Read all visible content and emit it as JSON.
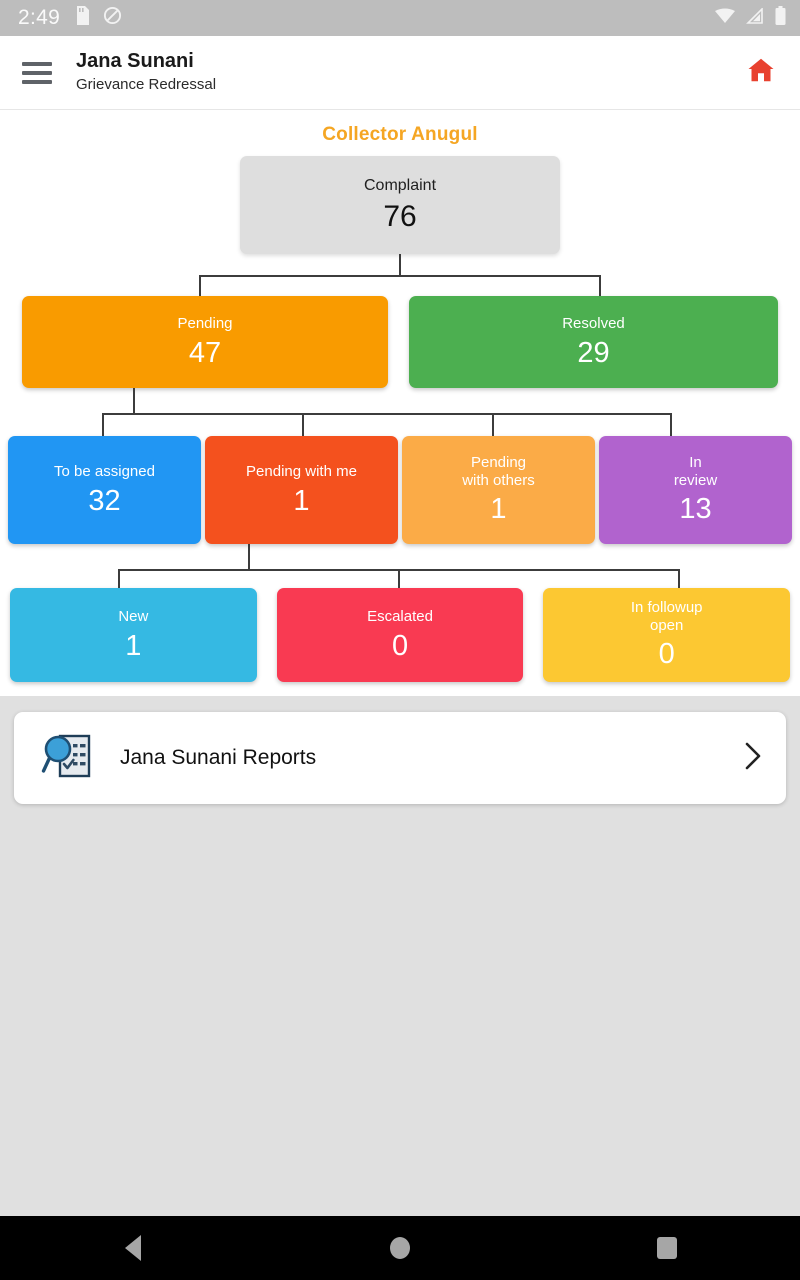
{
  "statusbar": {
    "time": "2:49",
    "icons_left": [
      "sd-card-icon",
      "do-not-disturb-icon"
    ],
    "icons_right": [
      "wifi-icon",
      "cellular-signal-icon",
      "battery-icon"
    ]
  },
  "appbar": {
    "menu_icon": "hamburger-menu-icon",
    "title": "Jana Sunani",
    "subtitle": "Grievance Redressal",
    "home_icon": "home-icon",
    "home_color": "#e8412f"
  },
  "dashboard": {
    "section_title": "Collector Anugul",
    "section_title_color": "#f5a623",
    "root": {
      "label": "Complaint",
      "value": "76",
      "color": "#dedede"
    },
    "level2": [
      {
        "label": "Pending",
        "value": "47",
        "color": "#f99b00"
      },
      {
        "label": "Resolved",
        "value": "29",
        "color": "#4caf50"
      }
    ],
    "level3": [
      {
        "label": "To be assigned",
        "value": "32",
        "color": "#2196f3"
      },
      {
        "label": "Pending with me",
        "value": "1",
        "color": "#f4511e"
      },
      {
        "label_line1": "Pending",
        "label_line2": "with others",
        "value": "1",
        "color": "#fbab47"
      },
      {
        "label_line1": "In",
        "label_line2": "review",
        "value": "13",
        "color": "#b163ce"
      }
    ],
    "level4": [
      {
        "label": "New",
        "value": "1",
        "color": "#35b9e3"
      },
      {
        "label": "Escalated",
        "value": "0",
        "color": "#f93a52"
      },
      {
        "label_line1": "In followup",
        "label_line2": "open",
        "value": "0",
        "color": "#fcc832"
      }
    ]
  },
  "reports": {
    "icon": "report-search-icon",
    "label": "Jana Sunani Reports",
    "chevron": "chevron-right-icon"
  },
  "navbar": {
    "back": "back-triangle-icon",
    "home": "home-circle-icon",
    "recents": "recents-square-icon"
  },
  "chart_data": {
    "type": "table",
    "title": "Collector Anugul",
    "categories": [
      "Complaint",
      "Pending",
      "Resolved",
      "To be assigned",
      "Pending with me",
      "Pending with others",
      "In review",
      "New",
      "Escalated",
      "In followup open"
    ],
    "values": [
      76,
      47,
      29,
      32,
      1,
      1,
      13,
      1,
      0,
      0
    ]
  }
}
